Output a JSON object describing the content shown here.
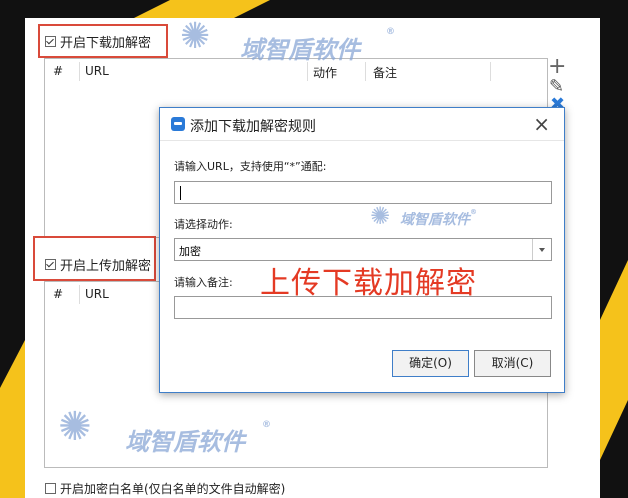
{
  "colors": {
    "accent_yellow": "#f5c21b",
    "dark": "#111111",
    "highlight_red": "#d94a3a",
    "overlay_text_red": "#e43a24",
    "dialog_border": "#3f7ec8"
  },
  "download_section": {
    "checkbox_label": "开启下载加解密",
    "checked": true,
    "columns": [
      "#",
      "URL",
      "动作",
      "备注"
    ]
  },
  "upload_section": {
    "checkbox_label": "开启上传加解密",
    "checked": true,
    "columns": [
      "#",
      "URL"
    ]
  },
  "bottom_checkbox_label": "开启加密白名单(仅白名单的文件自动解密)",
  "side_tools": [
    "plus-icon",
    "pencil-icon",
    "delete-icon"
  ],
  "dialog": {
    "title": "添加下载加解密规则",
    "url_label": "请输入URL，支持使用“*”通配:",
    "url_value": "",
    "action_label": "请选择动作:",
    "action_value": "加密",
    "note_label": "请输入备注:",
    "note_value": "",
    "ok_label": "确定(O)",
    "cancel_label": "取消(C)"
  },
  "overlay_caption": "上传下载加解密",
  "watermark": {
    "text": "域智盾软件",
    "mark": "®"
  }
}
